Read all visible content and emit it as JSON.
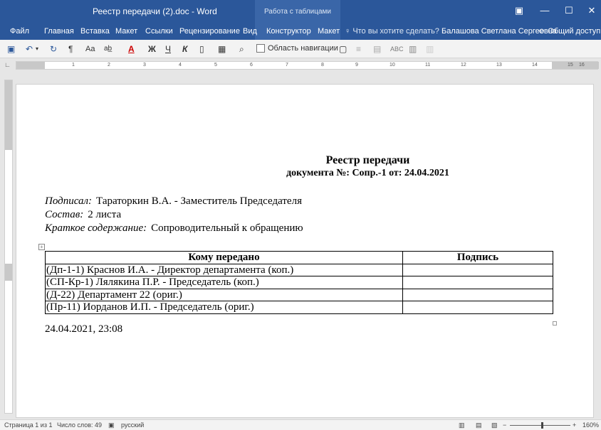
{
  "titlebar": {
    "document_title": "Реестр передачи (2).doc - Word",
    "context_title": "Работа с таблицами"
  },
  "ribbon": {
    "tabs": [
      "Файл",
      "Главная",
      "Вставка",
      "Макет",
      "Ссылки",
      "Рецензирование",
      "Вид",
      "Конструктор",
      "Макет"
    ],
    "tell_me": "Что вы хотите сделать?",
    "user": "Балашова Светлана Сергеевна",
    "share": "Общий доступ"
  },
  "qat": {
    "font_case": "Aa",
    "bold_cyr": "Ж",
    "underline_cyr": "Ч",
    "italic_cyr": "К",
    "nav_pane_label": "Область навигации"
  },
  "ruler": {
    "numbers": [
      "1",
      "2",
      "3",
      "4",
      "5",
      "6",
      "7",
      "8",
      "9",
      "10",
      "11",
      "12",
      "13",
      "14",
      "15",
      "16"
    ]
  },
  "document": {
    "heading": "Реестр передачи",
    "subheading": "документа №: Сопр.-1 от: 24.04.2021",
    "signed_label": "Подписал:",
    "signed_value": "Тараторкин В.А. - Заместитель Председателя",
    "composition_label": "Состав:",
    "composition_value": "2 листа",
    "summary_label": "Краткое содержание:",
    "summary_value": "Сопроводительный к обращению",
    "table": {
      "headers": [
        "Кому передано",
        "Подпись"
      ],
      "rows": [
        [
          "(Дп-1-1) Краснов И.А. - Директор департамента (коп.)",
          ""
        ],
        [
          "(СП-Кр-1) Лялякина П.Р. - Председатель (коп.)",
          ""
        ],
        [
          "(Д-22) Департамент 22 (ориг.)",
          ""
        ],
        [
          "(Пр-11) Иорданов И.П. - Председатель (ориг.)",
          ""
        ]
      ]
    },
    "timestamp": "24.04.2021, 23:08"
  },
  "status": {
    "page": "Страница 1 из 1",
    "words": "Число слов: 49",
    "language": "русский",
    "zoom": "160%"
  },
  "colors": {
    "ribbon_blue": "#2b579a"
  }
}
